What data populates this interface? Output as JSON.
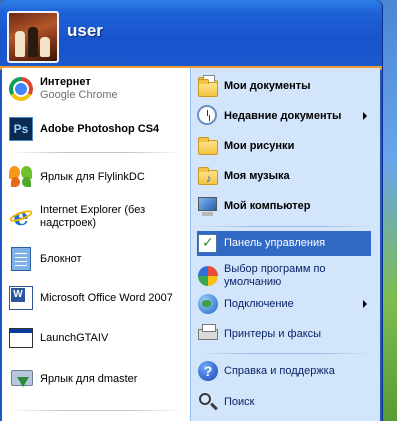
{
  "user": {
    "name": "user"
  },
  "pinned": [
    {
      "title": "Интернет",
      "subtitle": "Google Chrome",
      "icon": "chrome-icon"
    },
    {
      "title": "Adobe Photoshop CS4",
      "icon": "photoshop-icon"
    }
  ],
  "recent": [
    {
      "line1": "Ярлык для FlylinkDC",
      "line2": "",
      "icon": "flylinkdc-icon"
    },
    {
      "line1": "Internet Explorer (без",
      "line2": "надстроек)",
      "icon": "internet-explorer-icon"
    },
    {
      "line1": "Блокнот",
      "line2": "",
      "icon": "notepad-icon"
    },
    {
      "line1": "Microsoft Office Word 2007",
      "line2": "",
      "icon": "word-icon"
    },
    {
      "line1": "LaunchGTAIV",
      "line2": "",
      "icon": "window-icon"
    },
    {
      "line1": "Ярлык для dmaster",
      "line2": "",
      "icon": "dmaster-icon"
    }
  ],
  "places": [
    {
      "label": "Мои документы",
      "icon": "my-documents-icon"
    },
    {
      "label": "Недавние документы",
      "icon": "recent-documents-icon",
      "submenu": true
    },
    {
      "label": "Мои рисунки",
      "icon": "my-pictures-icon"
    },
    {
      "label": "Моя музыка",
      "icon": "my-music-icon"
    },
    {
      "label": "Мой компьютер",
      "icon": "my-computer-icon"
    }
  ],
  "settings": [
    {
      "label": "Панель управления",
      "icon": "control-panel-icon",
      "highlighted": true
    },
    {
      "line1": "Выбор программ по",
      "line2": "умолчанию",
      "icon": "default-programs-icon"
    },
    {
      "label": "Подключение",
      "icon": "connect-icon",
      "submenu": true
    },
    {
      "label": "Принтеры и факсы",
      "icon": "printers-icon"
    }
  ],
  "help": [
    {
      "label": "Справка и поддержка",
      "icon": "help-icon"
    },
    {
      "label": "Поиск",
      "icon": "search-icon"
    }
  ],
  "colors": {
    "header": "#1f57c8",
    "accent": "#f29b34",
    "right_panel": "#d3e5fa",
    "highlight": "#316ac5"
  }
}
